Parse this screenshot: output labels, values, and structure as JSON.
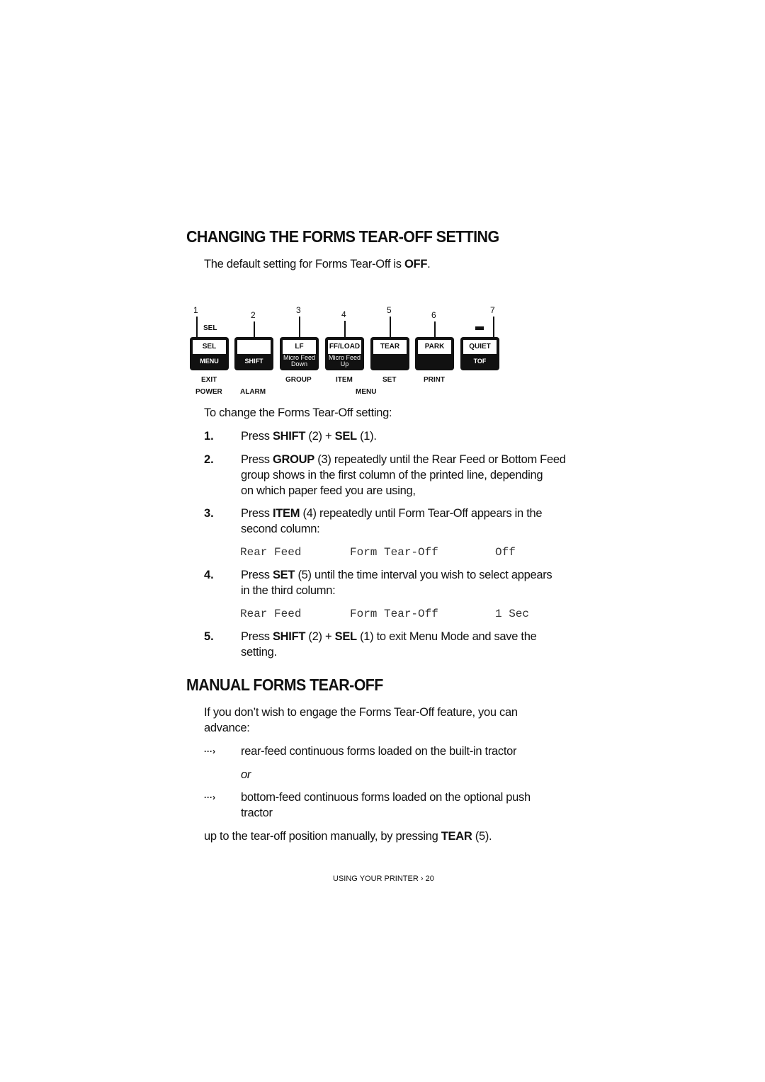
{
  "section1": {
    "title": "CHANGING THE FORMS TEAR-OFF SETTING",
    "intro_prefix": "The default setting for Forms Tear-Off is ",
    "intro_bold": "OFF",
    "intro_suffix": "."
  },
  "panel": {
    "sel_label": "SEL",
    "buttons": [
      {
        "num": "1",
        "top": "SEL",
        "bottom": "MENU"
      },
      {
        "num": "2",
        "top": "",
        "bottom": "SHIFT"
      },
      {
        "num": "3",
        "top": "LF",
        "bottom": "Micro Feed Down"
      },
      {
        "num": "4",
        "top": "FF/LOAD",
        "bottom": "Micro Feed Up"
      },
      {
        "num": "5",
        "top": "TEAR",
        "bottom": ""
      },
      {
        "num": "6",
        "top": "PARK",
        "bottom": ""
      },
      {
        "num": "7",
        "top": "QUIET",
        "bottom": "TOF"
      }
    ],
    "labels_row1": [
      "EXIT",
      "GROUP",
      "ITEM",
      "SET",
      "PRINT"
    ],
    "labels_row2": [
      "POWER",
      "ALARM",
      "MENU"
    ]
  },
  "steps_intro": "To change the Forms Tear-Off setting:",
  "steps": [
    {
      "n": "1.",
      "parts": [
        "Press ",
        "SHIFT",
        " (2) + ",
        "SEL",
        " (1)."
      ]
    },
    {
      "n": "2.",
      "lines": [
        "Press <b>GROUP</b> (3) repeatedly until the Rear Feed or Bottom Feed",
        "group shows in the first column of the printed line, depending",
        "on which paper feed you are using,"
      ]
    },
    {
      "n": "3.",
      "lines": [
        "Press <b>ITEM</b> (4) repeatedly until Form Tear-Off appears in the",
        "second column:"
      ]
    },
    {
      "n": "4.",
      "lines": [
        "Press <b>SET</b> (5) until the time interval you wish to select appears",
        "in the third column:"
      ]
    },
    {
      "n": "5.",
      "lines": [
        "Press <b>SHIFT</b> (2) + <b>SEL</b> (1) to exit Menu Mode and save the",
        "setting."
      ]
    }
  ],
  "printout1": [
    "Rear Feed",
    "Form Tear-Off",
    "Off"
  ],
  "printout2": [
    "Rear Feed",
    "Form Tear-Off",
    "1 Sec"
  ],
  "section2": {
    "title": "MANUAL FORMS TEAR-OFF",
    "intro1": "If you don’t wish to engage the Forms Tear-Off feature, you can",
    "intro2": "advance:",
    "bullet1": "rear-feed continuous forms loaded on the built-in tractor",
    "or": "or",
    "bullet2a": "bottom-feed continuous forms loaded on the optional push",
    "bullet2b": "tractor",
    "outro_prefix": "up to the tear-off position manually, by pressing ",
    "outro_bold": "TEAR",
    "outro_suffix": " (5)."
  },
  "footer": "USING YOUR PRINTER › 20"
}
